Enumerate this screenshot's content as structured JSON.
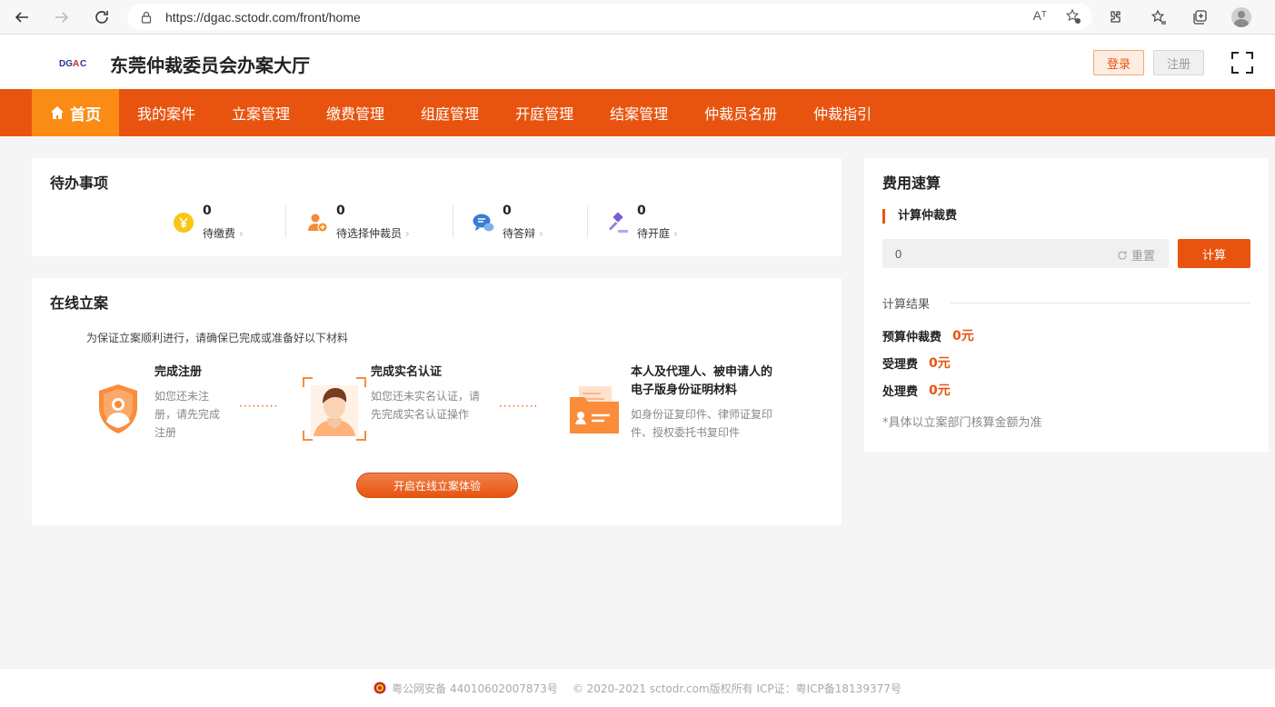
{
  "browser": {
    "url": "https://dgac.sctodr.com/front/home",
    "read_aloud": "Aᵀ"
  },
  "header": {
    "logo_text": "DGAC",
    "title": "东莞仲裁委员会办案大厅",
    "login": "登录",
    "register": "注册"
  },
  "nav": [
    {
      "label": "首页",
      "active": true
    },
    {
      "label": "我的案件"
    },
    {
      "label": "立案管理"
    },
    {
      "label": "缴费管理"
    },
    {
      "label": "组庭管理"
    },
    {
      "label": "开庭管理"
    },
    {
      "label": "结案管理"
    },
    {
      "label": "仲裁员名册"
    },
    {
      "label": "仲裁指引"
    }
  ],
  "todo": {
    "title": "待办事项",
    "items": [
      {
        "count": "0",
        "label": "待缴费",
        "icon": "yen-coin-icon"
      },
      {
        "count": "0",
        "label": "待选择仲裁员",
        "icon": "person-add-icon"
      },
      {
        "count": "0",
        "label": "待答辩",
        "icon": "chat-bubble-icon"
      },
      {
        "count": "0",
        "label": "待开庭",
        "icon": "gavel-icon"
      }
    ]
  },
  "online": {
    "title": "在线立案",
    "hint": "为保证立案顺利进行，请确保已完成或准备好以下材料",
    "steps": [
      {
        "title": "完成注册",
        "desc1": "如您还未注",
        "desc2": "册，请先完成",
        "desc3": "注册"
      },
      {
        "title": "完成实名认证",
        "desc1": "如您还未实名认证，请",
        "desc2": "先完成实名认证操作"
      },
      {
        "title1": "本人及代理人、被申请人的",
        "title2": "电子版身份证明材料",
        "desc1": "如身份证复印件、律师证复印",
        "desc2": "件、授权委托书复印件"
      }
    ],
    "dots": "·········",
    "start": "开启在线立案体验"
  },
  "calc": {
    "title": "费用速算",
    "subtitle": "计算仲裁费",
    "input_value": "0",
    "reset": "重置",
    "button": "计算",
    "result_label": "计算结果",
    "fees": [
      {
        "label": "预算仲裁费",
        "value": "0元"
      },
      {
        "label": "受理费",
        "value": "0元"
      },
      {
        "label": "处理费",
        "value": "0元"
      }
    ],
    "note": "*具体以立案部门核算金额为准"
  },
  "footer": {
    "police": "粤公网安备 44010602007873号",
    "copyright": "© 2020-2021 sctodr.com版权所有 ICP证：粤ICP备18139377号"
  },
  "colors": {
    "brand": "#e8540f",
    "nav_active": "#fa8c16"
  }
}
